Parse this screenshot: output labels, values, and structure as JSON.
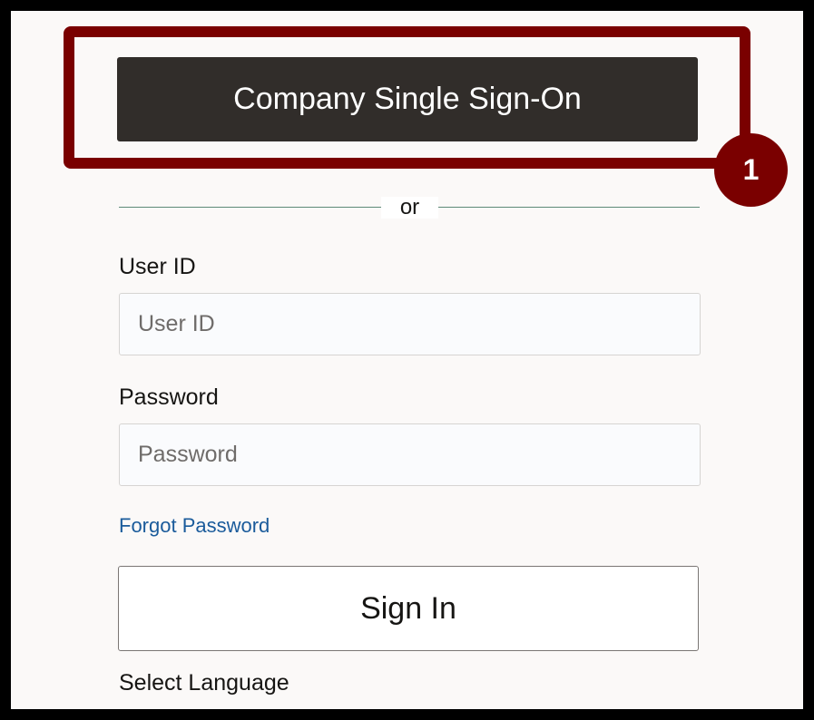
{
  "sso": {
    "label": "Company Single Sign-On"
  },
  "annotation": {
    "step": "1",
    "highlight_color": "#7a0000"
  },
  "divider": {
    "text": "or"
  },
  "user_id": {
    "label": "User ID",
    "placeholder": "User ID",
    "value": ""
  },
  "password": {
    "label": "Password",
    "placeholder": "Password",
    "value": ""
  },
  "forgot": {
    "label": "Forgot Password"
  },
  "signin": {
    "label": "Sign In"
  },
  "language": {
    "label": "Select Language"
  },
  "colors": {
    "sso_background": "#312d2a",
    "link": "#1a5b9b",
    "divider_line": "#5d8a78",
    "panel_background": "#fbf9f8"
  }
}
